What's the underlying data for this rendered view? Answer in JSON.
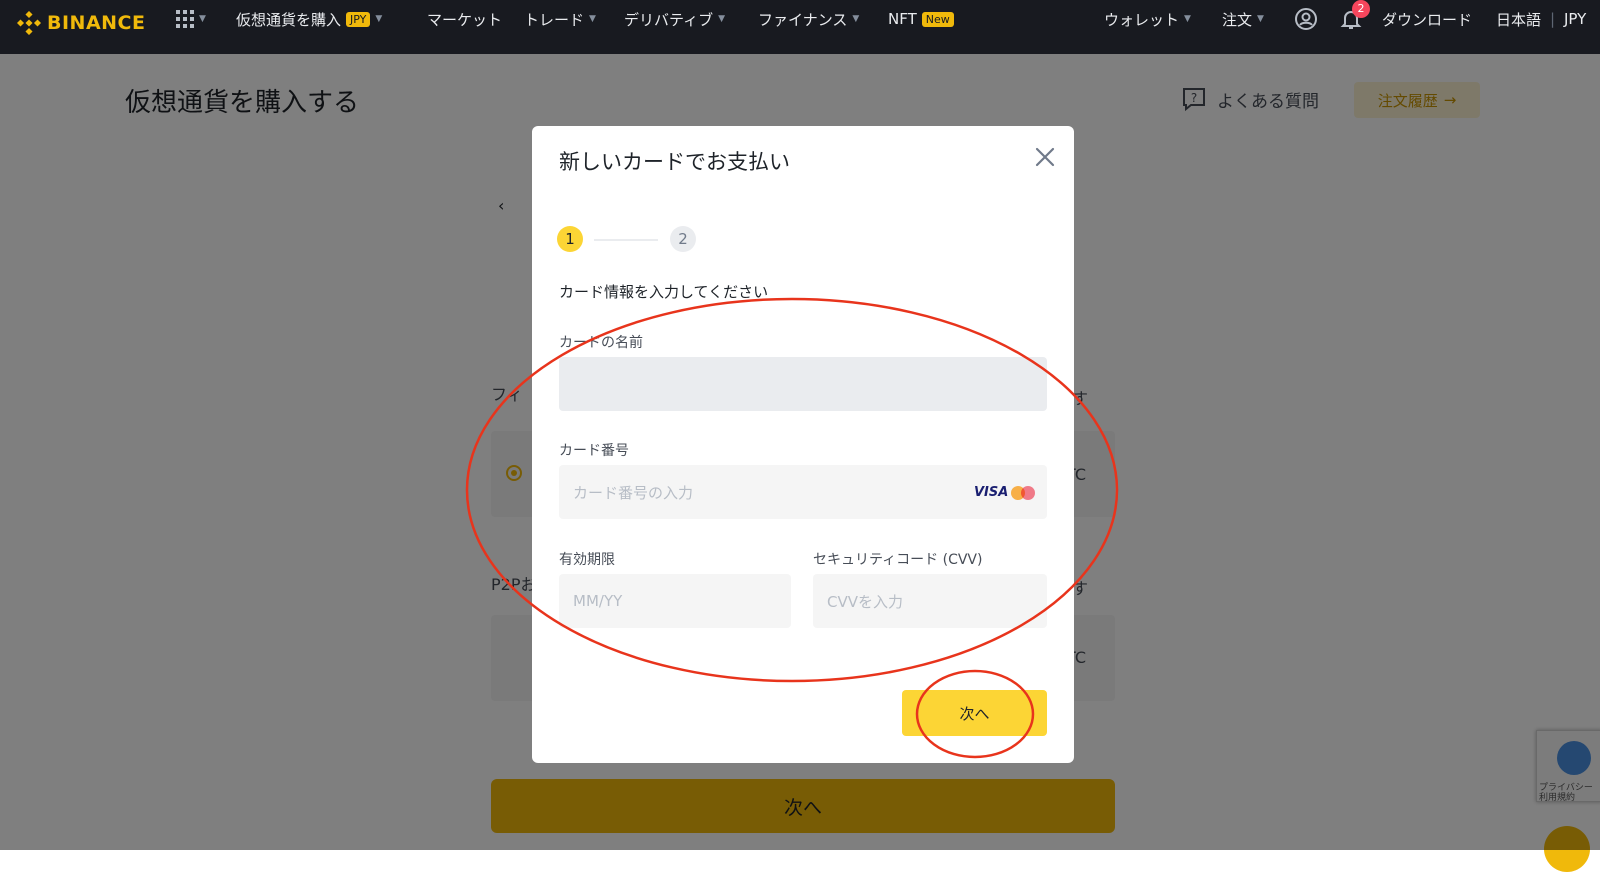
{
  "nav": {
    "brand": "BINANCE",
    "menu": [
      {
        "label": "仮想通貨を購入",
        "badge": "JPY"
      },
      {
        "label": "マーケット"
      },
      {
        "label": "トレード"
      },
      {
        "label": "デリバティブ"
      },
      {
        "label": "ファイナンス"
      },
      {
        "label": "NFT",
        "badge": "New"
      }
    ],
    "right": {
      "wallet": "ウォレット",
      "orders": "注文",
      "notification_count": "2",
      "download": "ダウンロード",
      "language": "日本語",
      "separator": "|",
      "currency": "JPY"
    },
    "icons": [
      "grid-icon",
      "user-icon",
      "bell-icon"
    ]
  },
  "page": {
    "title": "仮想通貨を購入する",
    "faq": "よくある質問",
    "order_history": "注文履歴",
    "section_label_1": "フィ",
    "section_label_2": "P2Pお",
    "right_fragment_1": "す",
    "right_fragment_2": "す",
    "ticker_1": "TC",
    "ticker_2": "TC",
    "next_button": "次へ"
  },
  "modal": {
    "title": "新しいカードでお支払い",
    "steps": [
      "1",
      "2"
    ],
    "active_step": 1,
    "instructions": "カード情報を入力してください",
    "fields": {
      "card_name": {
        "label": "カードの名前",
        "value": "",
        "placeholder": ""
      },
      "card_number": {
        "label": "カード番号",
        "placeholder": "カード番号の入力"
      },
      "expiry": {
        "label": "有効期限",
        "placeholder": "MM/YY"
      },
      "cvv": {
        "label": "セキュリティコード (CVV)",
        "placeholder": "CVVを入力"
      }
    },
    "card_brands": [
      "VISA",
      "mastercard-icon"
    ],
    "next_button": "次へ"
  },
  "recaptcha": {
    "line1": "プライバシー",
    "line2": "利用規約"
  },
  "colors": {
    "brand_yellow": "#fcd535",
    "nav_bg": "#181a20",
    "annotation_red": "#e8341c"
  }
}
